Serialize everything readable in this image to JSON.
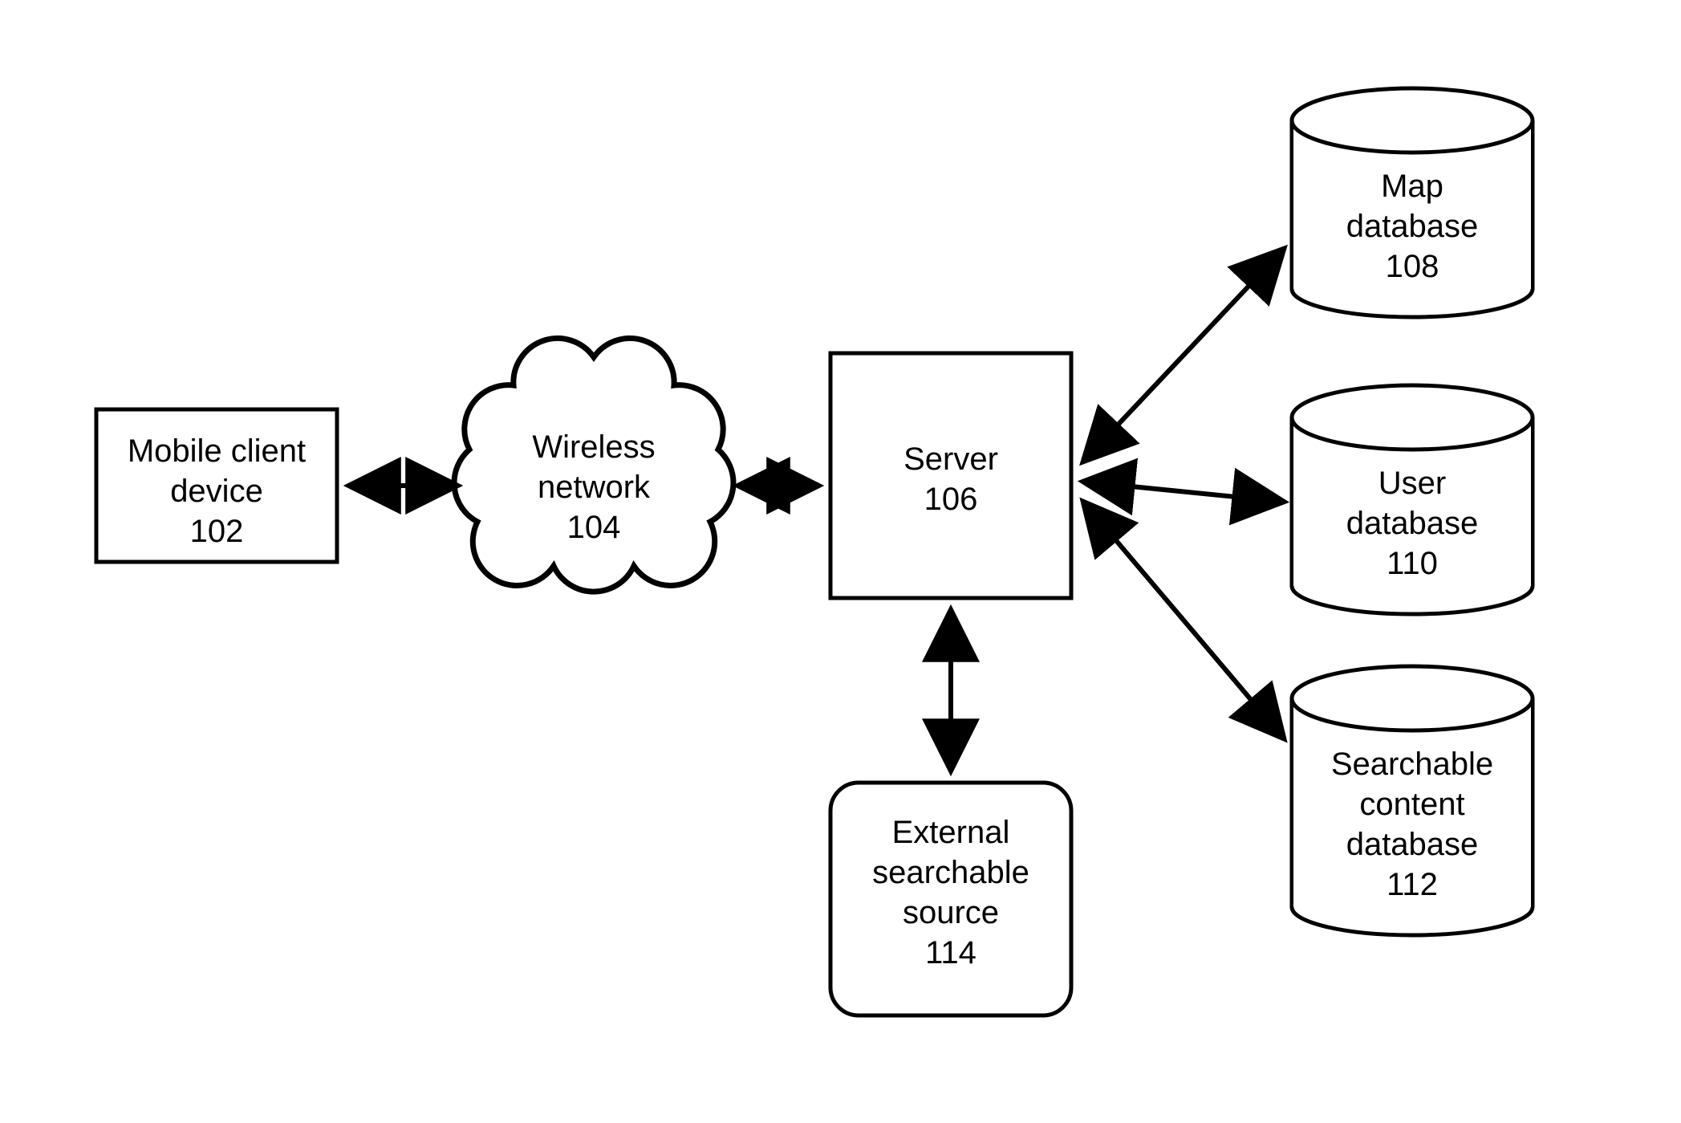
{
  "nodes": {
    "mobile": {
      "line1": "Mobile client",
      "line2": "device",
      "ref": "102"
    },
    "wireless": {
      "line1": "Wireless",
      "line2": "network",
      "ref": "104"
    },
    "server": {
      "line1": "Server",
      "ref": "106"
    },
    "mapdb": {
      "line1": "Map",
      "line2": "database",
      "ref": "108"
    },
    "userdb": {
      "line1": "User",
      "line2": "database",
      "ref": "110"
    },
    "searchdb": {
      "line1": "Searchable",
      "line2": "content",
      "line3": "database",
      "ref": "112"
    },
    "external": {
      "line1": "External",
      "line2": "searchable",
      "line3": "source",
      "ref": "114"
    }
  }
}
